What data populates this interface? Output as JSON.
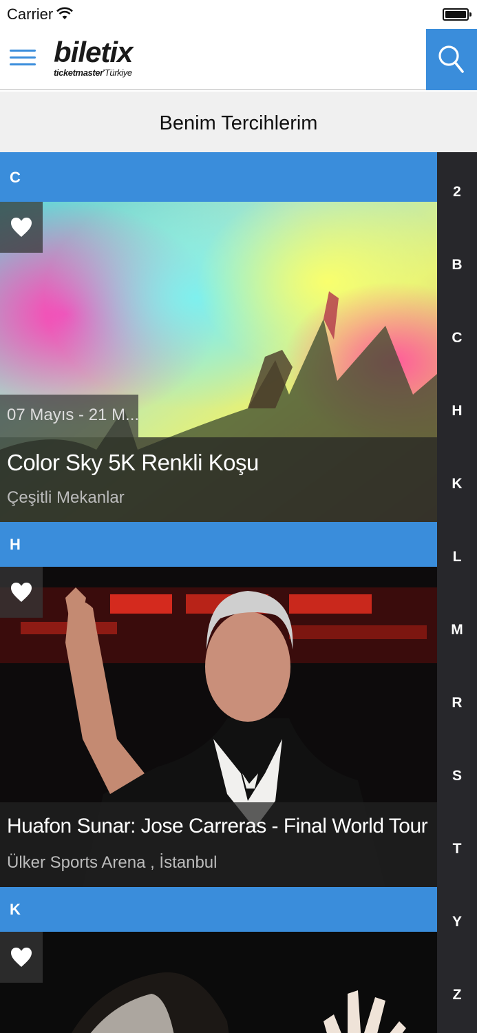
{
  "status_bar": {
    "carrier": "Carrier"
  },
  "nav": {
    "logo_main": "biletix",
    "logo_sub": "ticketmaster",
    "logo_country": "Türkiye"
  },
  "page": {
    "title": "Benim Tercihlerim"
  },
  "accent_color": "#3a8ddb",
  "sections": [
    {
      "letter": "C",
      "event": {
        "date": "07 Mayıs - 21 M...",
        "title": "Color Sky 5K  Renkli Koşu",
        "venue": "Çeşitli Mekanlar"
      }
    },
    {
      "letter": "H",
      "event": {
        "title": "Huafon Sunar: Jose Carreras - Final World Tour",
        "venue": "Ülker Sports Arena , İstanbul"
      }
    },
    {
      "letter": "K"
    }
  ],
  "index_letters": [
    "2",
    "B",
    "C",
    "H",
    "K",
    "L",
    "M",
    "R",
    "S",
    "T",
    "Y",
    "Z"
  ],
  "icons": {
    "menu": "hamburger-menu-icon",
    "search": "search-icon",
    "favorite": "heart-icon",
    "wifi": "wifi-icon",
    "battery": "battery-icon"
  }
}
